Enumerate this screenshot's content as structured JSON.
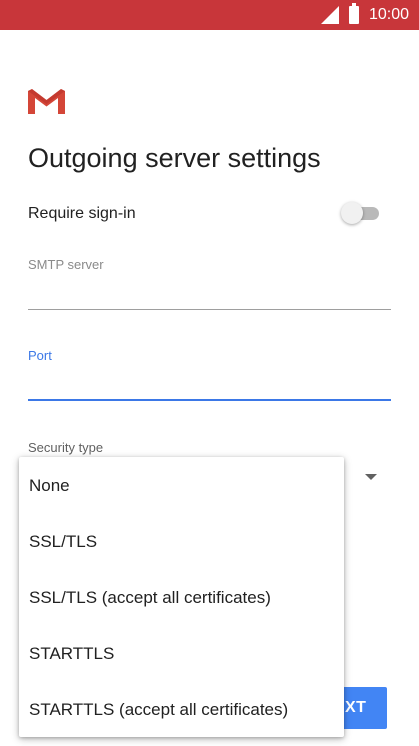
{
  "status_bar": {
    "time": "10:00",
    "icons": [
      "signal-icon",
      "battery-icon"
    ],
    "color": "#c8363a"
  },
  "app": {
    "logo_icon": "gmail-logo-icon",
    "brand_color": "#d44638"
  },
  "page": {
    "title": "Outgoing server settings"
  },
  "require_signin": {
    "label": "Require sign-in",
    "enabled": false
  },
  "smtp_server": {
    "label": "SMTP server",
    "value": ""
  },
  "port": {
    "label": "Port",
    "value": "",
    "accent": "#3b78e7"
  },
  "security_type": {
    "label": "Security type",
    "options": [
      "None",
      "SSL/TLS",
      "SSL/TLS (accept all certificates)",
      "STARTTLS",
      "STARTTLS (accept all certificates)"
    ]
  },
  "footer": {
    "next_label_visible": "XT",
    "button_color": "#4285f4"
  }
}
